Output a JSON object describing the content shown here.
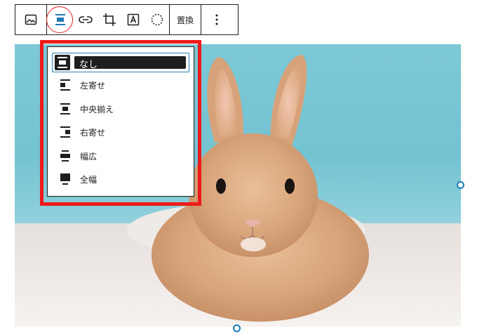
{
  "toolbar": {
    "replace_label": "置換",
    "icons": [
      "image-icon",
      "align-icon",
      "link-icon",
      "crop-icon",
      "text-overlay-icon",
      "dashed-circle-icon",
      "more-vertical-icon"
    ]
  },
  "align_menu": {
    "items": [
      {
        "label": "なし",
        "selected": true
      },
      {
        "label": "左寄せ"
      },
      {
        "label": "中央揃え"
      },
      {
        "label": "右寄せ"
      },
      {
        "label": "幅広"
      },
      {
        "label": "全幅"
      }
    ]
  },
  "colors": {
    "highlight_box": "#ef1a1a",
    "selection_border": "#2a7fb8",
    "handle": "#1d7ab8",
    "align_ring": "#e0201a"
  }
}
